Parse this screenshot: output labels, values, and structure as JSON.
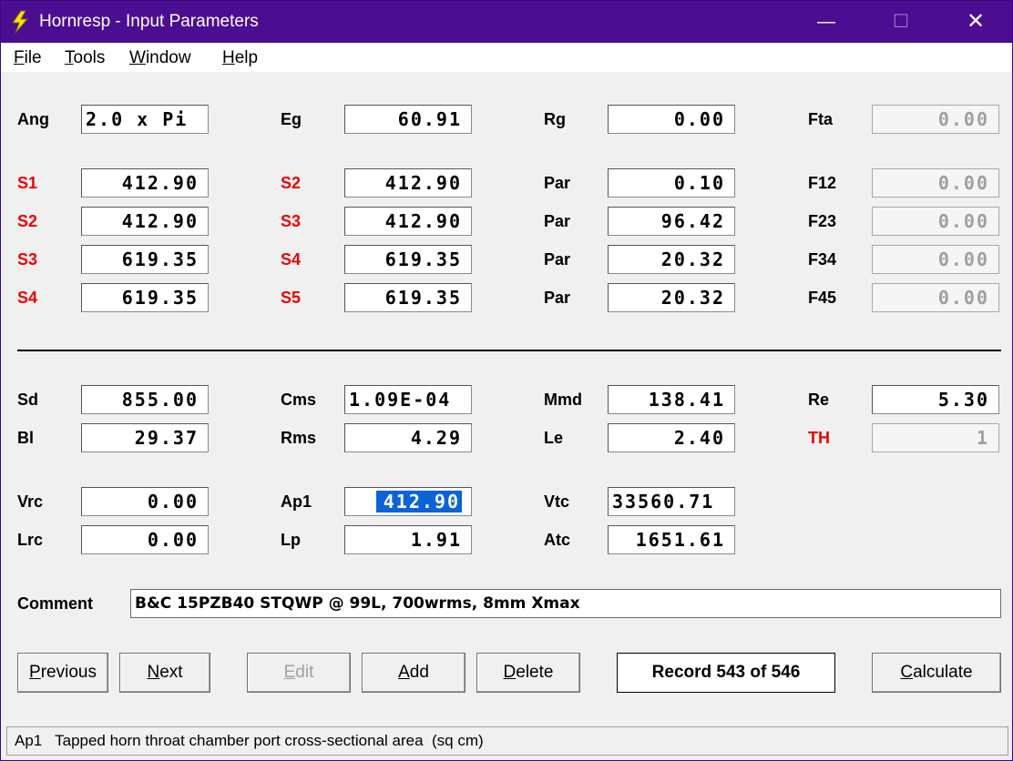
{
  "window": {
    "title": "Hornresp - Input Parameters",
    "title_color": "#4b0e93"
  },
  "menu": [
    {
      "key": "F",
      "rest": "ile"
    },
    {
      "key": "T",
      "rest": "ools"
    },
    {
      "key": "W",
      "rest": "indow"
    },
    {
      "key": "H",
      "rest": "elp"
    }
  ],
  "params": {
    "ang": {
      "label": "Ang",
      "value": "2.0 x Pi"
    },
    "eg": {
      "label": "Eg",
      "value": "60.91"
    },
    "rg": {
      "label": "Rg",
      "value": "0.00"
    },
    "fta": {
      "label": "Fta",
      "value": "0.00"
    },
    "r1": {
      "a_label": "S1",
      "a_value": "412.90",
      "b_label": "S2",
      "b_value": "412.90",
      "c_label": "Par",
      "c_value": "0.10",
      "d_label": "F12",
      "d_value": "0.00"
    },
    "r2": {
      "a_label": "S2",
      "a_value": "412.90",
      "b_label": "S3",
      "b_value": "412.90",
      "c_label": "Par",
      "c_value": "96.42",
      "d_label": "F23",
      "d_value": "0.00"
    },
    "r3": {
      "a_label": "S3",
      "a_value": "619.35",
      "b_label": "S4",
      "b_value": "619.35",
      "c_label": "Par",
      "c_value": "20.32",
      "d_label": "F34",
      "d_value": "0.00"
    },
    "r4": {
      "a_label": "S4",
      "a_value": "619.35",
      "b_label": "S5",
      "b_value": "619.35",
      "c_label": "Par",
      "c_value": "20.32",
      "d_label": "F45",
      "d_value": "0.00"
    },
    "sd": {
      "label": "Sd",
      "value": "855.00"
    },
    "cms": {
      "label": "Cms",
      "value": "1.09E-04"
    },
    "mmd": {
      "label": "Mmd",
      "value": "138.41"
    },
    "re": {
      "label": "Re",
      "value": "5.30"
    },
    "bl": {
      "label": "Bl",
      "value": "29.37"
    },
    "rms": {
      "label": "Rms",
      "value": "4.29"
    },
    "le": {
      "label": "Le",
      "value": "2.40"
    },
    "th": {
      "label": "TH",
      "value": "1"
    },
    "vrc": {
      "label": "Vrc",
      "value": "0.00"
    },
    "ap1": {
      "label": "Ap1",
      "value": "412.90"
    },
    "vtc": {
      "label": "Vtc",
      "value": "33560.71"
    },
    "lrc": {
      "label": "Lrc",
      "value": "0.00"
    },
    "lp": {
      "label": "Lp",
      "value": "1.91"
    },
    "atc": {
      "label": "Atc",
      "value": "1651.61"
    }
  },
  "comment": {
    "label": "Comment",
    "value": "B&C 15PZB40 STQWP @ 99L, 700wrms, 8mm Xmax"
  },
  "buttons": {
    "previous": {
      "key": "P",
      "rest": "revious"
    },
    "next": {
      "key": "N",
      "rest": "ext"
    },
    "edit": {
      "key": "E",
      "rest": "dit"
    },
    "add": {
      "key": "A",
      "rest": "dd"
    },
    "delete": {
      "key": "D",
      "rest": "elete"
    },
    "calculate": {
      "key": "C",
      "rest": "alculate"
    }
  },
  "record": "Record 543 of 546",
  "status": "Ap1   Tapped horn throat chamber port cross-sectional area  (sq cm)",
  "colors": {
    "label_red": "#ee0000",
    "selection": "#0a64d8"
  }
}
